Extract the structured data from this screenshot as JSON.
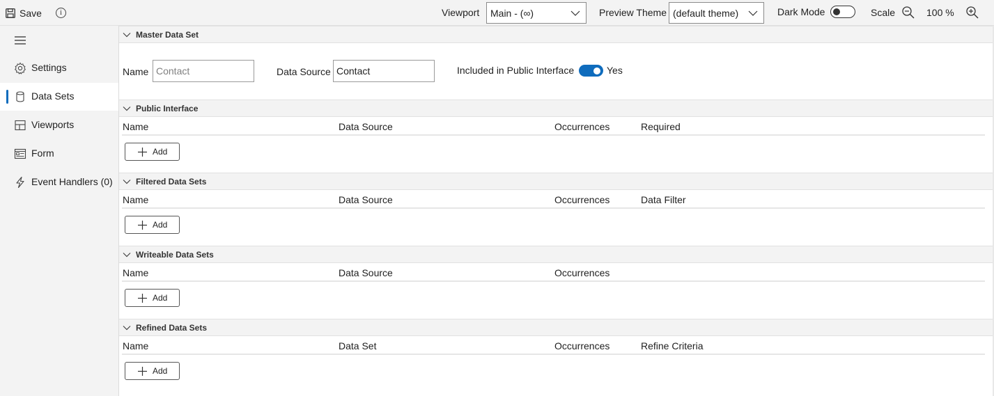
{
  "toolbar": {
    "save_label": "Save",
    "viewport_label": "Viewport",
    "viewport_value": "Main - (∞)",
    "theme_label": "Preview Theme",
    "theme_value": "(default theme)",
    "dark_mode_label": "Dark Mode",
    "scale_label": "Scale",
    "zoom_value": "100 %"
  },
  "sidebar": {
    "items": [
      {
        "label": "Settings",
        "icon": "gear-icon"
      },
      {
        "label": "Data Sets",
        "icon": "database-icon",
        "active": true
      },
      {
        "label": "Viewports",
        "icon": "layout-icon"
      },
      {
        "label": "Form",
        "icon": "form-icon"
      },
      {
        "label": "Event Handlers (0)",
        "icon": "lightning-icon"
      }
    ]
  },
  "master": {
    "title": "Master Data Set",
    "name_label": "Name",
    "name_placeholder": "Contact",
    "datasource_label": "Data Source",
    "datasource_value": "Contact",
    "public_label": "Included in Public Interface",
    "public_value": "Yes",
    "public_enabled": true
  },
  "sections": [
    {
      "title": "Public Interface",
      "columns": [
        "Name",
        "Data Source",
        "Occurrences",
        "Required"
      ],
      "add_label": "Add"
    },
    {
      "title": "Filtered Data Sets",
      "columns": [
        "Name",
        "Data Source",
        "Occurrences",
        "Data Filter"
      ],
      "add_label": "Add"
    },
    {
      "title": "Writeable Data Sets",
      "columns": [
        "Name",
        "Data Source",
        "Occurrences",
        ""
      ],
      "add_label": "Add"
    },
    {
      "title": "Refined Data Sets",
      "columns": [
        "Name",
        "Data Set",
        "Occurrences",
        "Refine Criteria"
      ],
      "add_label": "Add"
    }
  ],
  "colors": {
    "accent": "#0f6cbd",
    "toolbar_bg": "#f3f3f3",
    "sidebar_bg": "#f3f3f3"
  }
}
